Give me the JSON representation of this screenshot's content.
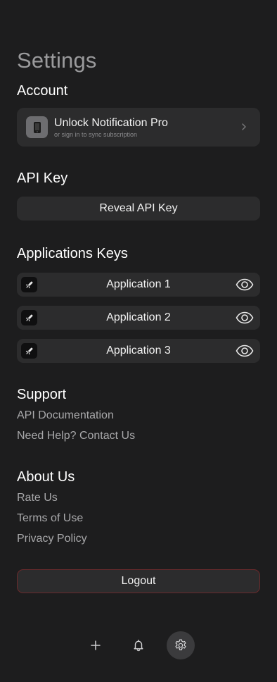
{
  "page": {
    "title": "Settings"
  },
  "account": {
    "heading": "Account",
    "pro_title": "Unlock Notification Pro",
    "pro_subtitle": "or sign in to sync subscription"
  },
  "api_key": {
    "heading": "API Key",
    "reveal_label": "Reveal API Key"
  },
  "applications": {
    "heading": "Applications Keys",
    "items": [
      {
        "label": "Application 1",
        "icon": "rocket-icon",
        "action_icon": "eye-icon"
      },
      {
        "label": "Application 2",
        "icon": "rocket-icon",
        "action_icon": "eye-icon"
      },
      {
        "label": "Application 3",
        "icon": "rocket-icon",
        "action_icon": "eye-icon"
      }
    ]
  },
  "support": {
    "heading": "Support",
    "links": [
      "API Documentation",
      "Need Help? Contact Us"
    ]
  },
  "about": {
    "heading": "About Us",
    "links": [
      "Rate Us",
      "Terms of Use",
      "Privacy Policy"
    ]
  },
  "logout_label": "Logout",
  "tabbar": {
    "items": [
      {
        "icon": "plus-icon",
        "active": false
      },
      {
        "icon": "bell-icon",
        "active": false
      },
      {
        "icon": "gear-icon",
        "active": true
      }
    ]
  },
  "colors": {
    "background": "#1d1d1e",
    "card": "#2c2c2d",
    "logout_border": "#6a2a2c",
    "muted_text": "#a8a8aa"
  }
}
